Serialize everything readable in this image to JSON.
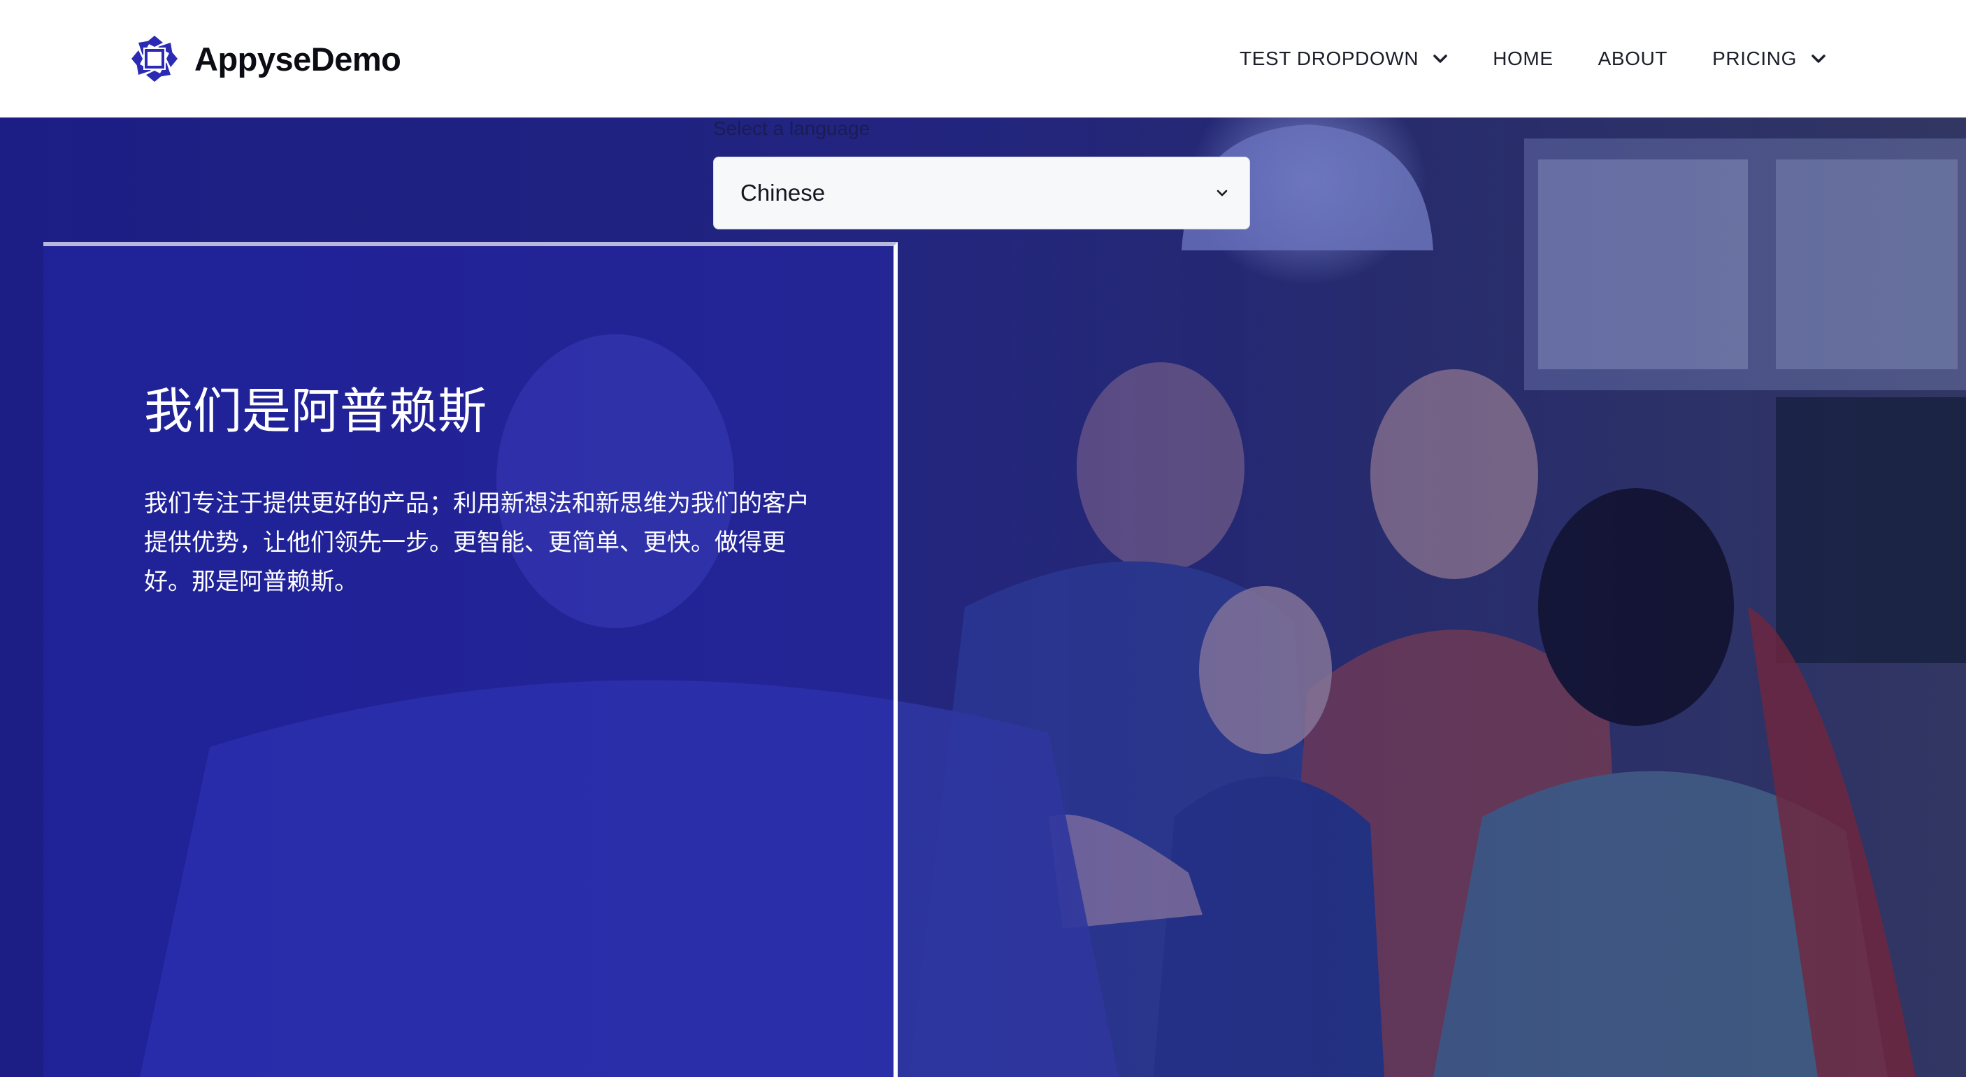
{
  "header": {
    "brand_name": "AppyseDemo",
    "nav": [
      {
        "label": "TEST DROPDOWN",
        "has_dropdown": true
      },
      {
        "label": "HOME",
        "has_dropdown": false
      },
      {
        "label": "ABOUT",
        "has_dropdown": false
      },
      {
        "label": "PRICING",
        "has_dropdown": true
      }
    ]
  },
  "language": {
    "label": "Select a language",
    "selected": "Chinese"
  },
  "hero": {
    "title": "我们是阿普赖斯",
    "body": "我们专注于提供更好的产品；利用新想法和新思维为我们的客户提供优势，让他们领先一步。更智能、更简单、更快。做得更好。那是阿普赖斯。"
  },
  "colors": {
    "brand": "#2a2ab4",
    "overlay": "#2828be",
    "text_dark": "#1c1f2a"
  },
  "icons": {
    "logo": "apryse-logo-icon",
    "dropdown": "chevron-down-icon"
  }
}
